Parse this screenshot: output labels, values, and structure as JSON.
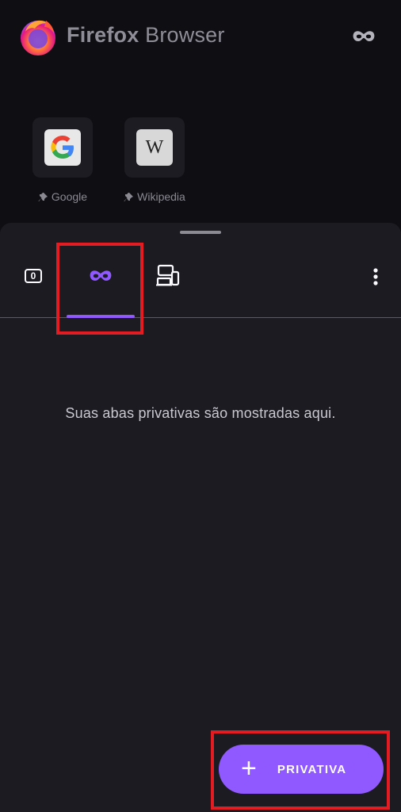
{
  "header": {
    "brand_bold": "Firefox",
    "brand_light": " Browser",
    "logo_icon": "firefox-logo",
    "private_icon": "private-mask-icon"
  },
  "shortcuts": [
    {
      "label": "Google",
      "icon": "google-g-icon",
      "pinned": true
    },
    {
      "label": "Wikipedia",
      "glyph": "W",
      "icon": "wikipedia-icon",
      "pinned": true
    }
  ],
  "tabs_tray": {
    "normal_tab_count": "0",
    "tabs": [
      "normal-tabs",
      "private-tabs",
      "synced-tabs"
    ],
    "selected_tab": "private-tabs",
    "empty_message": "Suas abas privativas são mostradas aqui.",
    "fab": {
      "icon_glyph": "+",
      "label": "PRIVATIVA"
    }
  },
  "colors": {
    "accent": "#9059ff",
    "background": "#0f0e12",
    "sheet": "#1c1b22",
    "annotation_red": "#e31b23"
  }
}
